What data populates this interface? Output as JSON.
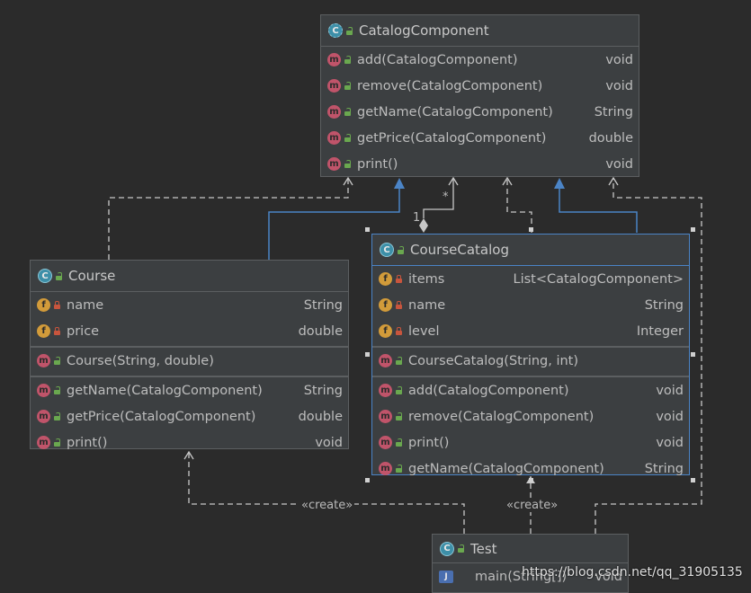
{
  "classes": {
    "catalog_component": {
      "name": "CatalogComponent",
      "methods": [
        {
          "name": "add(CatalogComponent)",
          "type": "void"
        },
        {
          "name": "remove(CatalogComponent)",
          "type": "void"
        },
        {
          "name": "getName(CatalogComponent)",
          "type": "String"
        },
        {
          "name": "getPrice(CatalogComponent)",
          "type": "double"
        },
        {
          "name": "print()",
          "type": "void"
        }
      ]
    },
    "course": {
      "name": "Course",
      "fields": [
        {
          "name": "name",
          "type": "String"
        },
        {
          "name": "price",
          "type": "double"
        }
      ],
      "constructor": {
        "name": "Course(String, double)"
      },
      "methods": [
        {
          "name": "getName(CatalogComponent)",
          "type": "String"
        },
        {
          "name": "getPrice(CatalogComponent)",
          "type": "double"
        },
        {
          "name": "print()",
          "type": "void"
        }
      ]
    },
    "course_catalog": {
      "name": "CourseCatalog",
      "fields": [
        {
          "name": "items",
          "type": "List<CatalogComponent>"
        },
        {
          "name": "name",
          "type": "String"
        },
        {
          "name": "level",
          "type": "Integer"
        }
      ],
      "constructor": {
        "name": "CourseCatalog(String, int)"
      },
      "methods": [
        {
          "name": "add(CatalogComponent)",
          "type": "void"
        },
        {
          "name": "remove(CatalogComponent)",
          "type": "void"
        },
        {
          "name": "print()",
          "type": "void"
        },
        {
          "name": "getName(CatalogComponent)",
          "type": "String"
        }
      ]
    },
    "test": {
      "name": "Test",
      "methods": [
        {
          "name": "main(String[])",
          "type": "void"
        }
      ]
    }
  },
  "edges": {
    "multiplicity_one": "1",
    "multiplicity_many": "*",
    "create_label_left": "«create»",
    "create_label_right": "«create»"
  },
  "icons": {
    "class": "class-icon",
    "abstract_class": "abstract-class-icon",
    "method": "method-icon",
    "field": "field-icon",
    "public": "public-lock-icon",
    "private": "private-lock-icon",
    "main_runnable": "runnable-class-icon"
  },
  "colors": {
    "background": "#2b2b2b",
    "box": "#3c3f41",
    "selected_border": "#4b84c6",
    "inheritance_line": "#4b84c6",
    "dependency_line": "#c8c8c8"
  },
  "watermark": "https://blog.csdn.net/qq_31905135"
}
